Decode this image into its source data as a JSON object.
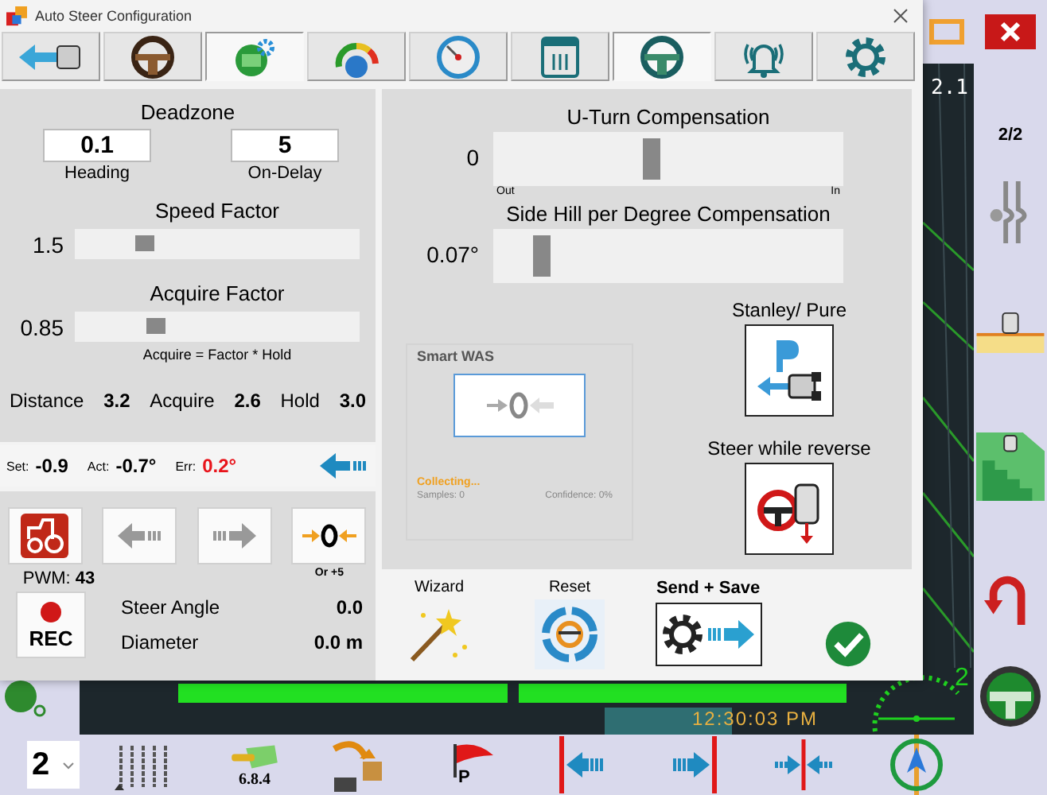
{
  "dialog": {
    "title": "Auto Steer Configuration",
    "tabs": [
      {
        "selected": false
      },
      {
        "selected": false
      },
      {
        "selected": true
      },
      {
        "selected": false
      },
      {
        "selected": false
      },
      {
        "selected": false
      },
      {
        "selected": true
      },
      {
        "selected": false
      },
      {
        "selected": false
      }
    ],
    "deadzone": {
      "title": "Deadzone",
      "fields": [
        {
          "value": "0.1",
          "label": "Heading"
        },
        {
          "value": "5",
          "label": "On-Delay"
        }
      ]
    },
    "speed_factor": {
      "title": "Speed Factor",
      "value": "1.5",
      "level": 0.23
    },
    "acquire_factor": {
      "title": "Acquire Factor",
      "value": "0.85",
      "level": 0.27,
      "note": "Acquire = Factor * Hold"
    },
    "readouts": [
      {
        "label": "Distance",
        "value": "3.2"
      },
      {
        "label": "Acquire",
        "value": "2.6"
      },
      {
        "label": "Hold",
        "value": "3.0"
      }
    ],
    "status": [
      {
        "label": "Set:",
        "value": "-0.9",
        "kind": "normal"
      },
      {
        "label": "Act:",
        "value": "-0.7°",
        "kind": "normal"
      },
      {
        "label": "Err:",
        "value": "0.2°",
        "kind": "error"
      }
    ],
    "pwm": {
      "label": "PWM:",
      "value": "43"
    },
    "zero_hint": "Or +5",
    "rec": "REC",
    "steer_angle": {
      "label": "Steer Angle",
      "value": "0.0"
    },
    "diameter": {
      "label": "Diameter",
      "value": "0.0 m"
    },
    "uturn": {
      "title": "U-Turn Compensation",
      "value": "0",
      "level": 0.45,
      "min_label": "Out",
      "max_label": "In"
    },
    "side_hill": {
      "title": "Side Hill per Degree Compensation",
      "value": "0.07°",
      "level": 0.12
    },
    "smart_was": {
      "title": "Smart WAS",
      "status": "Collecting...",
      "samples": "Samples: 0",
      "confidence": "Confidence: 0%"
    },
    "stanley_pure": "Stanley/ Pure",
    "steer_reverse": "Steer while reverse",
    "footer": {
      "wizard": "Wizard",
      "reset": "Reset",
      "send_save": "Send + Save"
    }
  },
  "background": {
    "zoom": "2.1",
    "page": "2/2",
    "gauge": "2",
    "clock": "12:30:03 PM",
    "version": "6.8.4",
    "flag_label": "P",
    "section_count": "2"
  }
}
